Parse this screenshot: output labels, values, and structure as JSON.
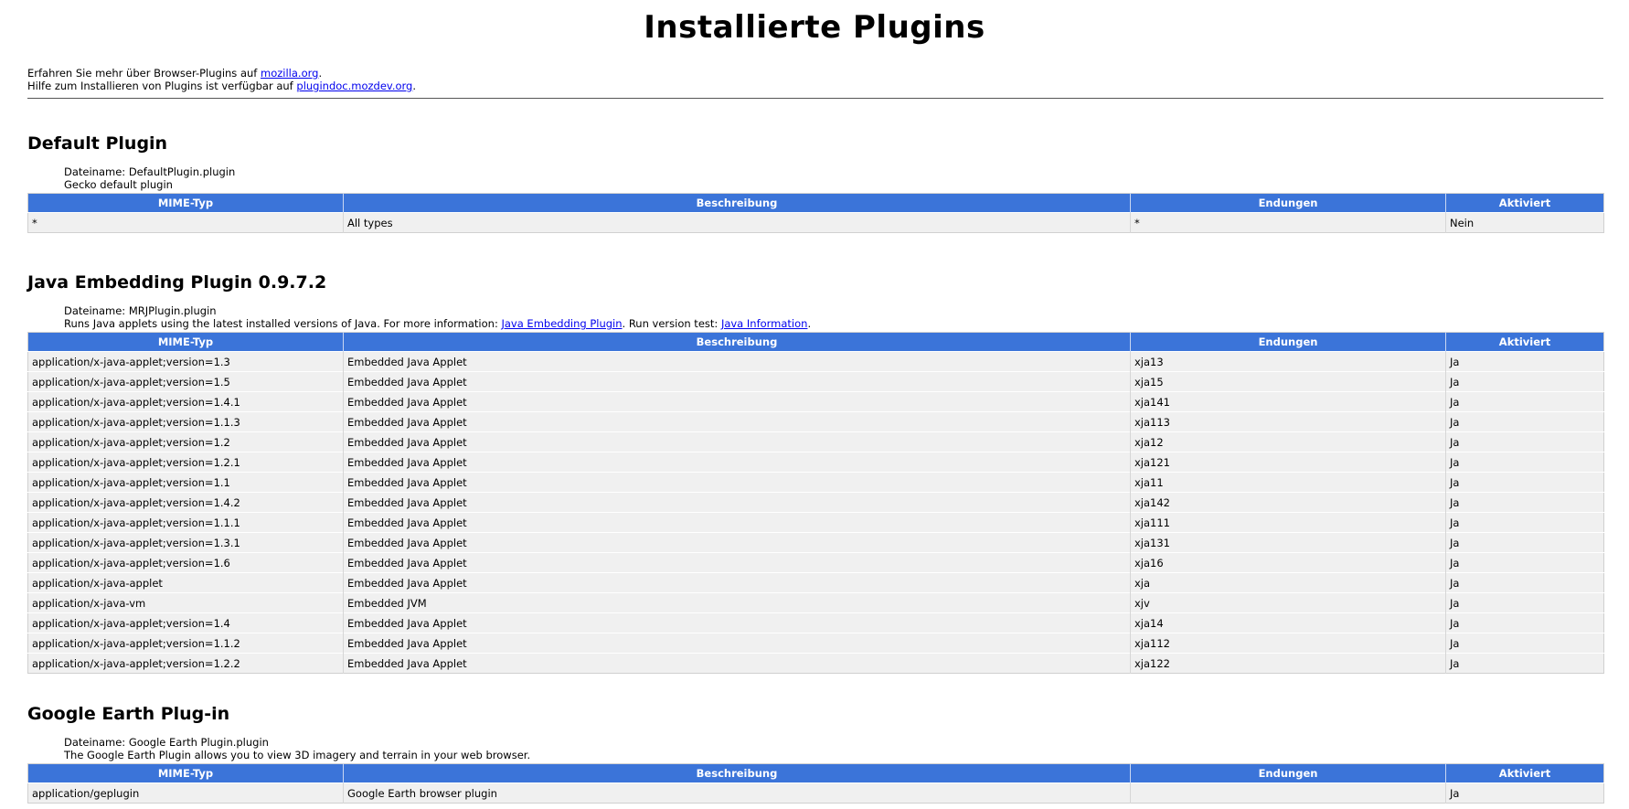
{
  "page": {
    "title": "Installierte Plugins",
    "intro": [
      {
        "text": "Erfahren Sie mehr über Browser-Plugins auf ",
        "link": "mozilla.org",
        "after": "."
      },
      {
        "text": "Hilfe zum Installieren von Plugins ist verfügbar auf ",
        "link": "plugindoc.mozdev.org",
        "after": "."
      }
    ]
  },
  "table_headers": [
    "MIME-Typ",
    "Beschreibung",
    "Endungen",
    "Aktiviert"
  ],
  "plugins": [
    {
      "name": "Default Plugin",
      "filename": "Dateiname: DefaultPlugin.plugin",
      "description": "Gecko default plugin",
      "rows": [
        [
          "*",
          "All types",
          "*",
          "Nein"
        ]
      ]
    },
    {
      "name": "Java Embedding Plugin 0.9.7.2",
      "filename": "Dateiname: MRJPlugin.plugin",
      "description_parts": {
        "pre": "Runs Java applets using the latest installed versions of Java. For more information: ",
        "link1": "Java Embedding Plugin",
        "mid": ". Run version test: ",
        "link2": "Java Information",
        "post": "."
      },
      "rows": [
        [
          "application/x-java-applet;version=1.3",
          "Embedded Java Applet",
          "xja13",
          "Ja"
        ],
        [
          "application/x-java-applet;version=1.5",
          "Embedded Java Applet",
          "xja15",
          "Ja"
        ],
        [
          "application/x-java-applet;version=1.4.1",
          "Embedded Java Applet",
          "xja141",
          "Ja"
        ],
        [
          "application/x-java-applet;version=1.1.3",
          "Embedded Java Applet",
          "xja113",
          "Ja"
        ],
        [
          "application/x-java-applet;version=1.2",
          "Embedded Java Applet",
          "xja12",
          "Ja"
        ],
        [
          "application/x-java-applet;version=1.2.1",
          "Embedded Java Applet",
          "xja121",
          "Ja"
        ],
        [
          "application/x-java-applet;version=1.1",
          "Embedded Java Applet",
          "xja11",
          "Ja"
        ],
        [
          "application/x-java-applet;version=1.4.2",
          "Embedded Java Applet",
          "xja142",
          "Ja"
        ],
        [
          "application/x-java-applet;version=1.1.1",
          "Embedded Java Applet",
          "xja111",
          "Ja"
        ],
        [
          "application/x-java-applet;version=1.3.1",
          "Embedded Java Applet",
          "xja131",
          "Ja"
        ],
        [
          "application/x-java-applet;version=1.6",
          "Embedded Java Applet",
          "xja16",
          "Ja"
        ],
        [
          "application/x-java-applet",
          "Embedded Java Applet",
          "xja",
          "Ja"
        ],
        [
          "application/x-java-vm",
          "Embedded JVM",
          "xjv",
          "Ja"
        ],
        [
          "application/x-java-applet;version=1.4",
          "Embedded Java Applet",
          "xja14",
          "Ja"
        ],
        [
          "application/x-java-applet;version=1.1.2",
          "Embedded Java Applet",
          "xja112",
          "Ja"
        ],
        [
          "application/x-java-applet;version=1.2.2",
          "Embedded Java Applet",
          "xja122",
          "Ja"
        ]
      ]
    },
    {
      "name": "Google Earth Plug-in",
      "filename": "Dateiname: Google Earth Plugin.plugin",
      "description": "The Google Earth Plugin allows you to view 3D imagery and terrain in your web browser.",
      "rows": [
        [
          "application/geplugin",
          "Google Earth browser plugin",
          "",
          "Ja"
        ]
      ]
    }
  ]
}
